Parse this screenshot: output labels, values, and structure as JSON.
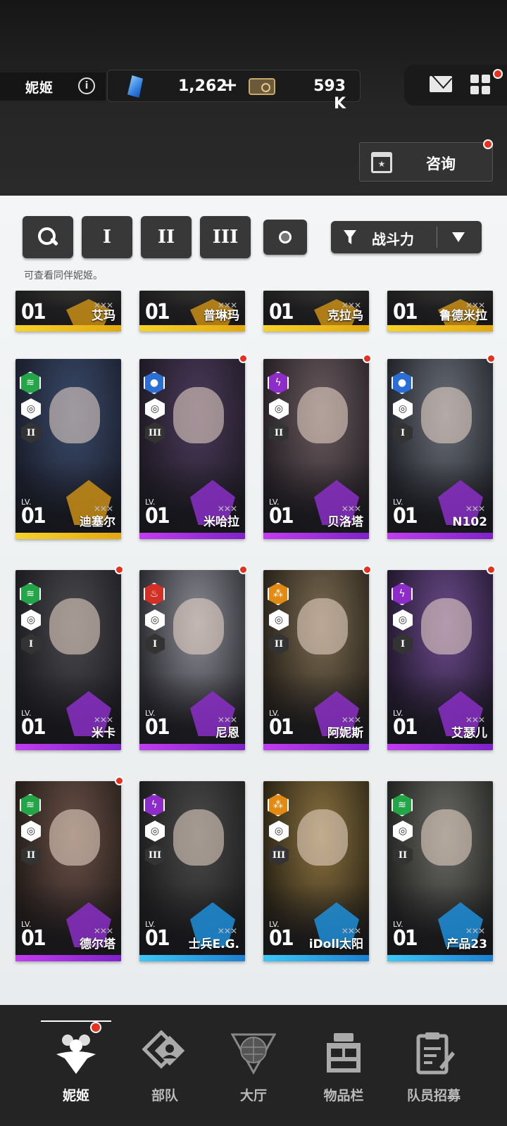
{
  "header": {
    "title": "妮姬",
    "gems": "1,262",
    "gems_plus": "+",
    "credits": "593 K",
    "consult_label": "咨询",
    "icons": [
      "info-icon",
      "gem-icon",
      "credit-card-icon",
      "mail-icon",
      "grid-menu-icon",
      "calendar-icon"
    ]
  },
  "filters": {
    "search_icon": "search-icon",
    "burst_1": "I",
    "burst_2": "II",
    "burst_3": "III",
    "all_icon": "circle-icon",
    "sort_label": "战斗力",
    "hint": "可查看同伴妮姬。"
  },
  "cards": [
    {
      "name": "艾玛",
      "lv_text": "LV.",
      "lv": "01",
      "rarity": "gold",
      "partial": true
    },
    {
      "name": "普琳玛",
      "lv_text": "LV.",
      "lv": "01",
      "rarity": "gold",
      "partial": true
    },
    {
      "name": "克拉乌",
      "lv_text": "LV.",
      "lv": "01",
      "rarity": "gold",
      "partial": true
    },
    {
      "name": "鲁德米拉",
      "lv_text": "LV.",
      "lv": "01",
      "rarity": "gold",
      "partial": true
    },
    {
      "name": "迪塞尔",
      "lv_text": "LV.",
      "lv": "01",
      "rarity": "gold",
      "element": "green",
      "tier": "II",
      "dot": false
    },
    {
      "name": "米哈拉",
      "lv_text": "LV.",
      "lv": "01",
      "rarity": "purple",
      "element": "blue",
      "tier": "III",
      "dot": true
    },
    {
      "name": "贝洛塔",
      "lv_text": "LV.",
      "lv": "01",
      "rarity": "purple",
      "element": "purple",
      "tier": "II",
      "dot": true
    },
    {
      "name": "N102",
      "lv_text": "LV.",
      "lv": "01",
      "rarity": "purple",
      "element": "blue",
      "tier": "I",
      "dot": true
    },
    {
      "name": "米卡",
      "lv_text": "LV.",
      "lv": "01",
      "rarity": "purple",
      "element": "green",
      "tier": "I",
      "dot": true
    },
    {
      "name": "尼恩",
      "lv_text": "LV.",
      "lv": "01",
      "rarity": "purple",
      "element": "red",
      "tier": "I",
      "dot": true
    },
    {
      "name": "阿妮斯",
      "lv_text": "LV.",
      "lv": "01",
      "rarity": "purple",
      "element": "orange",
      "tier": "II",
      "dot": true
    },
    {
      "name": "艾瑟儿",
      "lv_text": "LV.",
      "lv": "01",
      "rarity": "purple",
      "element": "purple",
      "tier": "I",
      "dot": true
    },
    {
      "name": "德尔塔",
      "lv_text": "LV.",
      "lv": "01",
      "rarity": "purple",
      "element": "green",
      "tier": "II",
      "dot": true
    },
    {
      "name": "士兵E.G.",
      "lv_text": "LV.",
      "lv": "01",
      "rarity": "blue",
      "element": "purple",
      "tier": "III",
      "dot": false
    },
    {
      "name": "iDoll太阳",
      "lv_text": "LV.",
      "lv": "01",
      "rarity": "blue",
      "element": "orange",
      "tier": "III",
      "dot": false
    },
    {
      "name": "产品23",
      "lv_text": "LV.",
      "lv": "01",
      "rarity": "blue",
      "element": "green",
      "tier": "II",
      "dot": false
    }
  ],
  "nav": [
    {
      "label": "妮姬",
      "icon": "nikke-icon",
      "active": true
    },
    {
      "label": "部队",
      "icon": "squad-icon",
      "active": false
    },
    {
      "label": "大厅",
      "icon": "lobby-icon",
      "active": false
    },
    {
      "label": "物品栏",
      "icon": "inventory-icon",
      "active": false
    },
    {
      "label": "队员招募",
      "icon": "recruit-icon",
      "active": false
    }
  ],
  "colors": {
    "gold": "#f2c01e",
    "purple": "#a636e0",
    "blue": "#2aa7e8",
    "badge_red": "#e8301f"
  }
}
